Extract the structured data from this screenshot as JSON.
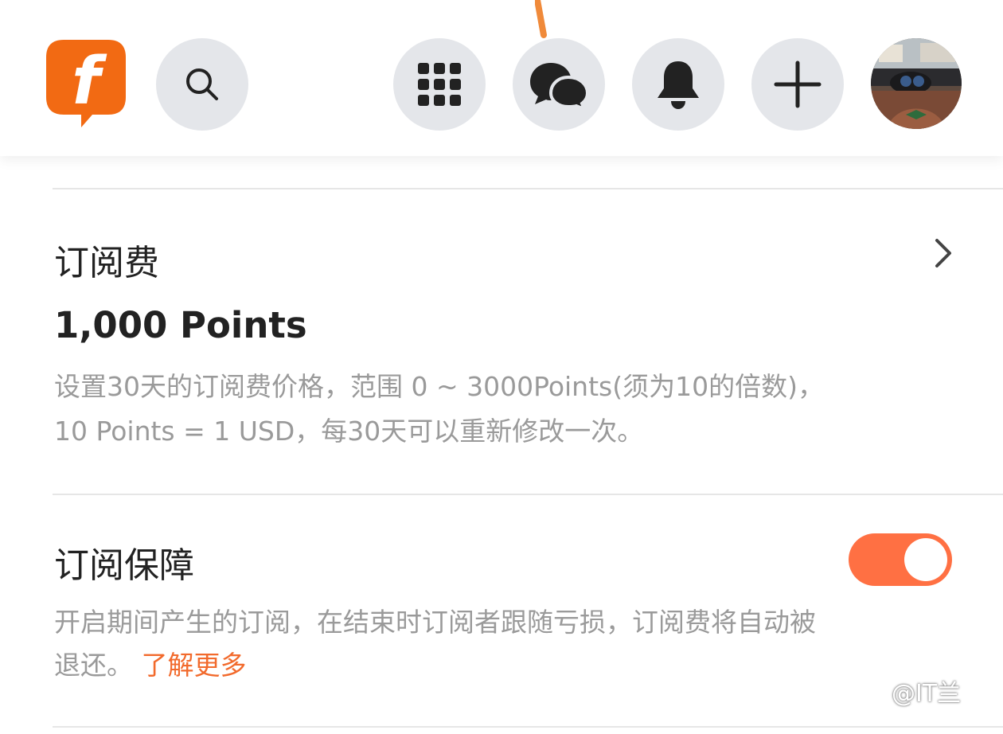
{
  "header": {
    "brand_color": "#f26a13",
    "icon_bg": "#e4e6ea",
    "icons": [
      "logo-icon",
      "search-icon",
      "apps-grid-icon",
      "chat-icon",
      "bell-icon",
      "plus-icon",
      "avatar"
    ]
  },
  "subscription_fee": {
    "title": "订阅费",
    "price": "1,000 Points",
    "desc_line1": "设置30天的订阅费价格，范围 0 ~ 3000Points(须为10的倍数)，",
    "desc_line2": "10 Points = 1 USD，每30天可以重新修改一次。"
  },
  "subscription_protection": {
    "title": "订阅保障",
    "desc_line1": "开启期间产生的订阅，在结束时订阅者跟随亏损，订阅费将自动被",
    "desc_line2": "退还。",
    "learn_more": "了解更多",
    "toggle_on": true,
    "toggle_color": "#ff7043"
  },
  "watermark": "@IT兰"
}
